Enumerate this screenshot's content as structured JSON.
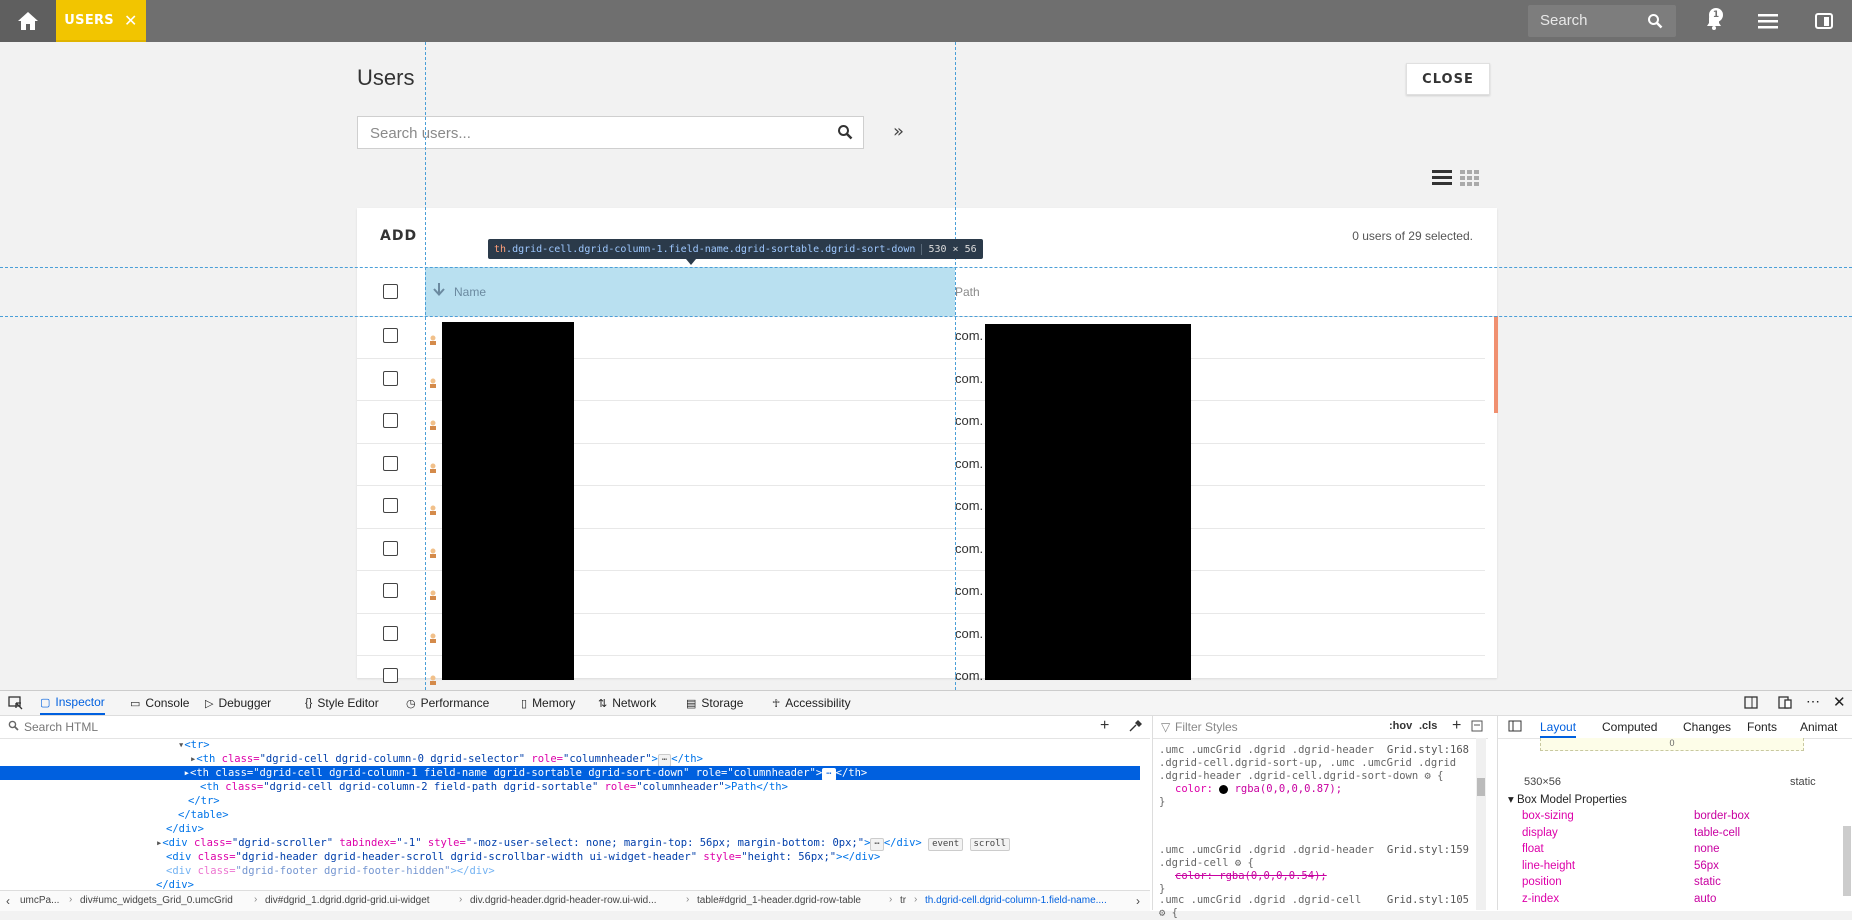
{
  "topbar": {
    "tab_label": "USERS",
    "search_placeholder": "Search",
    "notification_count": "1",
    "colors": {
      "bar": "#6f6f6f",
      "tab": "#f2c500"
    }
  },
  "page": {
    "title": "Users",
    "close_label": "CLOSE",
    "search_placeholder": "Search users...",
    "more_label": "»"
  },
  "grid": {
    "add_label": "ADD",
    "selection_status": "0 users of 29 selected.",
    "columns": {
      "name": "Name",
      "path": "Path"
    },
    "rows": [
      {
        "path_prefix": "com."
      },
      {
        "path_prefix": "com."
      },
      {
        "path_prefix": "com."
      },
      {
        "path_prefix": "com."
      },
      {
        "path_prefix": "com."
      },
      {
        "path_prefix": "com."
      },
      {
        "path_prefix": "com."
      },
      {
        "path_prefix": "com."
      },
      {
        "path_prefix": "com."
      }
    ]
  },
  "inspector_tooltip": {
    "selector_tag": "th",
    "selector_rest": ".dgrid-cell.dgrid-column-1.field-name.dgrid-sortable.dgrid-sort-down",
    "dims": "530 × 56"
  },
  "devtools": {
    "tabs": [
      "Inspector",
      "Console",
      "Debugger",
      "Style Editor",
      "Performance",
      "Memory",
      "Network",
      "Storage",
      "Accessibility"
    ],
    "search_html_placeholder": "Search HTML",
    "filter_styles_placeholder": "Filter Styles",
    "hov_label": ":hov",
    "cls_label": ".cls",
    "layout_tabs": [
      "Layout",
      "Computed",
      "Changes",
      "Fonts",
      "Animat"
    ],
    "box_margin_value": "0",
    "box_size": "530×56",
    "box_position": "static",
    "box_model_title": "Box Model Properties",
    "box_props": [
      {
        "name": "box-sizing",
        "value": "border-box"
      },
      {
        "name": "display",
        "value": "table-cell"
      },
      {
        "name": "float",
        "value": "none"
      },
      {
        "name": "line-height",
        "value": "56px"
      },
      {
        "name": "position",
        "value": "static"
      },
      {
        "name": "z-index",
        "value": "auto"
      }
    ],
    "html_lines": {
      "l0": "<tr>",
      "l1a": "<th ",
      "l1b": "class=",
      "l1c": "\"dgrid-cell dgrid-column-0 dgrid-selector\"",
      "l1d": " role=",
      "l1e": "\"columnheader\"",
      "l1f": ">",
      "l1g": "</th>",
      "l2a": "<th ",
      "l2b": "class=",
      "l2c": "\"dgrid-cell dgrid-column-1 field-name dgrid-sortable dgrid-sort-down\"",
      "l2d": " role=",
      "l2e": "\"columnheader\"",
      "l2f": ">",
      "l2g": "</th>",
      "l3a": "<th ",
      "l3b": "class=",
      "l3c": "\"dgrid-cell dgrid-column-2 field-path dgrid-sortable\"",
      "l3d": " role=",
      "l3e": "\"columnheader\"",
      "l3f": ">Path",
      "l3g": "</th>",
      "l4": "</tr>",
      "l5": "</table>",
      "l6": "</div>",
      "l7a": "<div ",
      "l7b": "class=",
      "l7c": "\"dgrid-scroller\"",
      "l7d": " tabindex=",
      "l7e": "\"-1\"",
      "l7f": " style=",
      "l7g": "\"-moz-user-select: none; margin-top: 56px; margin-bottom: 0px;\"",
      "l7h": ">",
      "l7i": "</div>",
      "badge_event": "event",
      "badge_scroll": "scroll",
      "l8a": "<div ",
      "l8b": "class=",
      "l8c": "\"dgrid-header dgrid-header-scroll dgrid-scrollbar-width ui-widget-header\"",
      "l8d": " style=",
      "l8e": "\"height: 56px;\"",
      "l8f": "></div>",
      "l9a": "<div ",
      "l9b": "class=",
      "l9c": "\"dgrid-footer dgrid-footer-hidden\"",
      "l9d": "></div>",
      "l10": "</div>"
    },
    "styles": {
      "r1_sel": ".umc .umcGrid .dgrid .dgrid-header .dgrid-cell.dgrid-sort-up, .umc .umcGrid .dgrid .dgrid-header .dgrid-cell.dgrid-sort-down ⚙ {",
      "r1_src": "Grid.styl:168",
      "r1_prop": "color:",
      "r1_val": "rgba(0,0,0,0.87);",
      "r2_sel": ".umc .umcGrid .dgrid .dgrid-header .dgrid-cell ⚙ {",
      "r2_src": "Grid.styl:159",
      "r2_prop": "color: rgba(0,0,0,0.54);",
      "r3_sel": ".umc .umcGrid .dgrid .dgrid-cell",
      "r3_src": "Grid.styl:105",
      "r3_tail": "⚙ {"
    },
    "breadcrumbs": [
      "umcPa...",
      "div#umc_widgets_Grid_0.umcGrid",
      "div#dgrid_1.dgrid.dgrid-grid.ui-widget",
      "div.dgrid-header.dgrid-header-row.ui-wid...",
      "table#dgrid_1-header.dgrid-row-table",
      "tr",
      "th.dgrid-cell.dgrid-column-1.field-name...."
    ]
  }
}
